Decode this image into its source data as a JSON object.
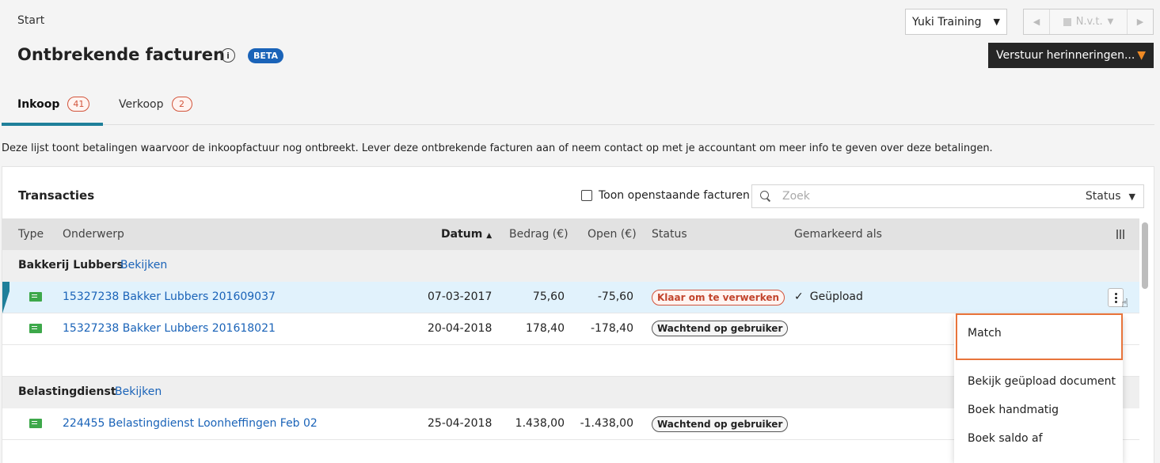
{
  "breadcrumb": "Start",
  "page": {
    "title": "Ontbrekende facturen",
    "info_icon": "i",
    "badge": "BETA"
  },
  "company_select": {
    "value": "Yuki Training"
  },
  "period": {
    "prev": "◀",
    "value": "N.v.t.",
    "next": "▶"
  },
  "send_button": {
    "label": "Verstuur herinneringen..."
  },
  "tabs": [
    {
      "label": "Inkoop",
      "count": "41"
    },
    {
      "label": "Verkoop",
      "count": "2"
    }
  ],
  "description": "Deze lijst toont betalingen waarvoor de inkoopfactuur nog ontbreekt. Lever deze ontbrekende facturen aan of neem contact op met je accountant om meer info te geven over deze betalingen.",
  "panel": {
    "title": "Transacties",
    "checkbox_label": "Toon openstaande facturen",
    "search_placeholder": "Zoek",
    "status_filter": "Status"
  },
  "columns": {
    "type": "Type",
    "subject": "Onderwerp",
    "date": "Datum",
    "amount": "Bedrag (€)",
    "open": "Open (€)",
    "status": "Status",
    "marked": "Gemarkeerd als"
  },
  "groups": [
    {
      "name": "Bakkerij Lubbers",
      "link": "Bekijken",
      "rows": [
        {
          "subject": "15327238 Bakker Lubbers 201609037",
          "date": "07-03-2017",
          "amount": "75,60",
          "open": "-75,60",
          "status": "Klaar om te verwerken",
          "marked": "Geüpload"
        },
        {
          "subject": "15327238 Bakker Lubbers 201618021",
          "date": "20-04-2018",
          "amount": "178,40",
          "open": "-178,40",
          "status": "Wachtend op gebruiker",
          "marked": ""
        }
      ]
    },
    {
      "name": "Belastingdienst",
      "link": "Bekijken",
      "rows": [
        {
          "subject": "224455 Belastingdienst Loonheffingen Feb 02",
          "date": "25-04-2018",
          "amount": "1.438,00",
          "open": "-1.438,00",
          "status": "Wachtend op gebruiker",
          "marked": ""
        }
      ]
    }
  ],
  "context_menu": [
    "Match",
    "Bekijk geüpload document",
    "Boek handmatig",
    "Boek saldo af"
  ],
  "colors": {
    "accent": "#1e7f9a",
    "link": "#1a63b8",
    "highlight": "#e8743b",
    "orange_badge": "#d2543b"
  }
}
